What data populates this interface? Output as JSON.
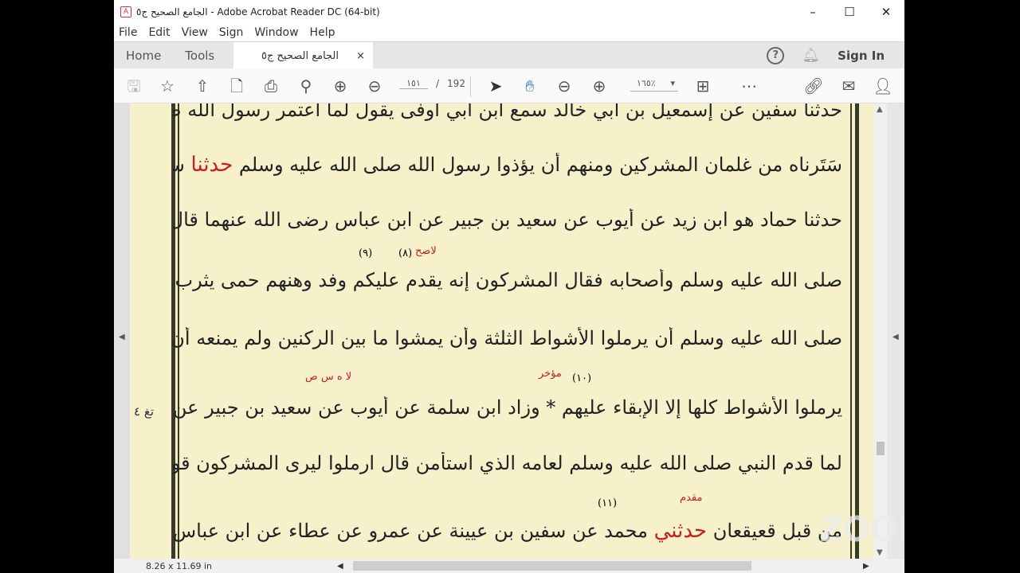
{
  "window": {
    "title": "الجامع الصحيح ج٥ - Adobe Acrobat Reader DC (64-bit)",
    "minimize": "–",
    "maximize": "☐",
    "close": "✕"
  },
  "menu": [
    "File",
    "Edit",
    "View",
    "Sign",
    "Window",
    "Help"
  ],
  "tabs": {
    "home": "Home",
    "tools": "Tools",
    "document": "الجامع الصحيح ج٥",
    "close": "×"
  },
  "header": {
    "help": "?",
    "sign_in": "Sign In"
  },
  "toolbar": {
    "page_current": "١٥١",
    "page_sep": "/",
    "page_total": "192",
    "zoom": "١٦٥٪"
  },
  "document": {
    "lines": [
      "حدثنا سفين عن إسمعيل بن أبي خالد سمع ابن أبي أوفى يقول لما اعتمر رسول الله صلى الله عليه وسلم",
      {
        "a": "سَتَرناه من غلمان المشركين ومنهم أن يؤذوا رسول الله صلى الله عليه وسلم",
        "red": "حدثنا",
        "b": "سليمن بن حرب"
      },
      "حدثنا حماد هو ابن زيد عن أيوب عن سعيد بن جبير عن ابن عباس رضى الله عنهما قال قدم رسول الله",
      "صلى الله عليه وسلم وأصحابه فقال المشركون إنه يقدم عليكم وفد وهنهم حمى يثرب وأمرهم النبي",
      "صلى الله عليه وسلم أن يرملوا الأشواط الثلثة وأن يمشوا ما بين الركنين ولم يمنعه أن يأمرهم أن",
      "يرملوا الأشواط كلها إلا الإبقاء عليهم * وزاد ابن سلمة عن أيوب عن سعيد بن جبير عن ابن عباس قال",
      "لما قدم النبي صلى الله عليه وسلم لعامه الذي استأمن قال ارملوا ليرى المشركون قوتهم والمشركون",
      {
        "a": "من قبل قعيقعان",
        "red": "حدثني",
        "b": "محمد عن سفين بن عيينة عن عمرو عن عطاء عن ابن عباس رضى الله عنهما"
      }
    ],
    "annotations": {
      "n9": "(٩)",
      "n8": "(٨)",
      "sah": "لاصح",
      "lahs": "لا ه س ص",
      "muakhkhar": "مؤخر",
      "n10": "(١٠)",
      "muqaddam": "مقدم",
      "n11": "(١١)"
    },
    "side_note": "تغ ٤"
  },
  "watermark": "zoom",
  "status": {
    "page_size": "8.26 x 11.69 in"
  }
}
